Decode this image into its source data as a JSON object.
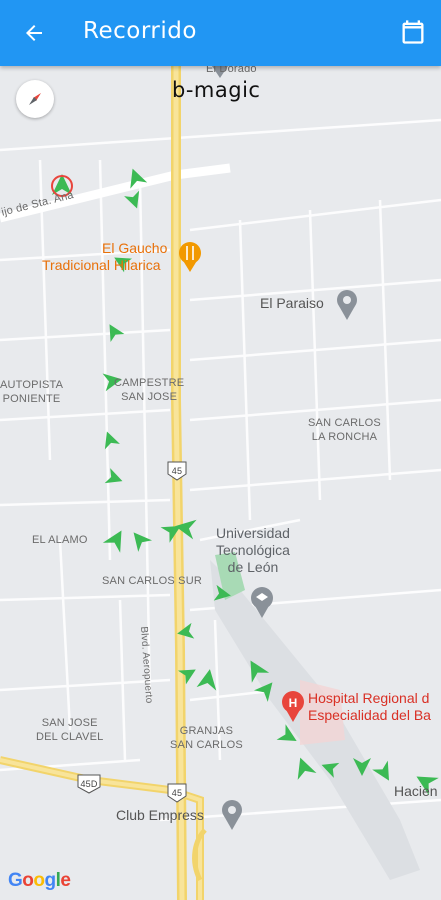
{
  "header": {
    "title": "Recorrido",
    "back_icon": "arrow-back-icon",
    "calendar_icon": "calendar-icon",
    "background": "#2196f3"
  },
  "brand": "b-magic",
  "map": {
    "attribution": "Google",
    "labels": {
      "el_dorado": "El Dorado",
      "camino": "ijo de Sta. Ana",
      "el_gaucho_1": "El Gaucho",
      "el_gaucho_2": "Tradicional Hilarica",
      "el_paraiso": "El Paraiso",
      "autopista_1": "AUTOPISTA",
      "autopista_2": "PONIENTE",
      "campestre_1": "CAMPESTRE",
      "campestre_2": "SAN JOSE",
      "san_carlos_roncha_1": "SAN CARLOS",
      "san_carlos_roncha_2": "LA RONCHA",
      "el_alamo": "EL ALAMO",
      "san_carlos_sur": "SAN CARLOS SUR",
      "universidad_1": "Universidad",
      "universidad_2": "Tecnológica",
      "universidad_3": "de León",
      "hospital_1": "Hospital Regional d",
      "hospital_2": "Especialidad del Ba",
      "san_jose_clavel_1": "SAN JOSE",
      "san_jose_clavel_2": "DEL CLAVEL",
      "granjas_1": "GRANJAS",
      "granjas_2": "SAN CARLOS",
      "club_empress": "Club Empress",
      "hacienda": "Hacien",
      "aeropuerto": "Blvd. Aeropuerto",
      "shield_45a": "45",
      "shield_45b": "45",
      "shield_450": "45D"
    },
    "route_color": "#3cba54"
  }
}
